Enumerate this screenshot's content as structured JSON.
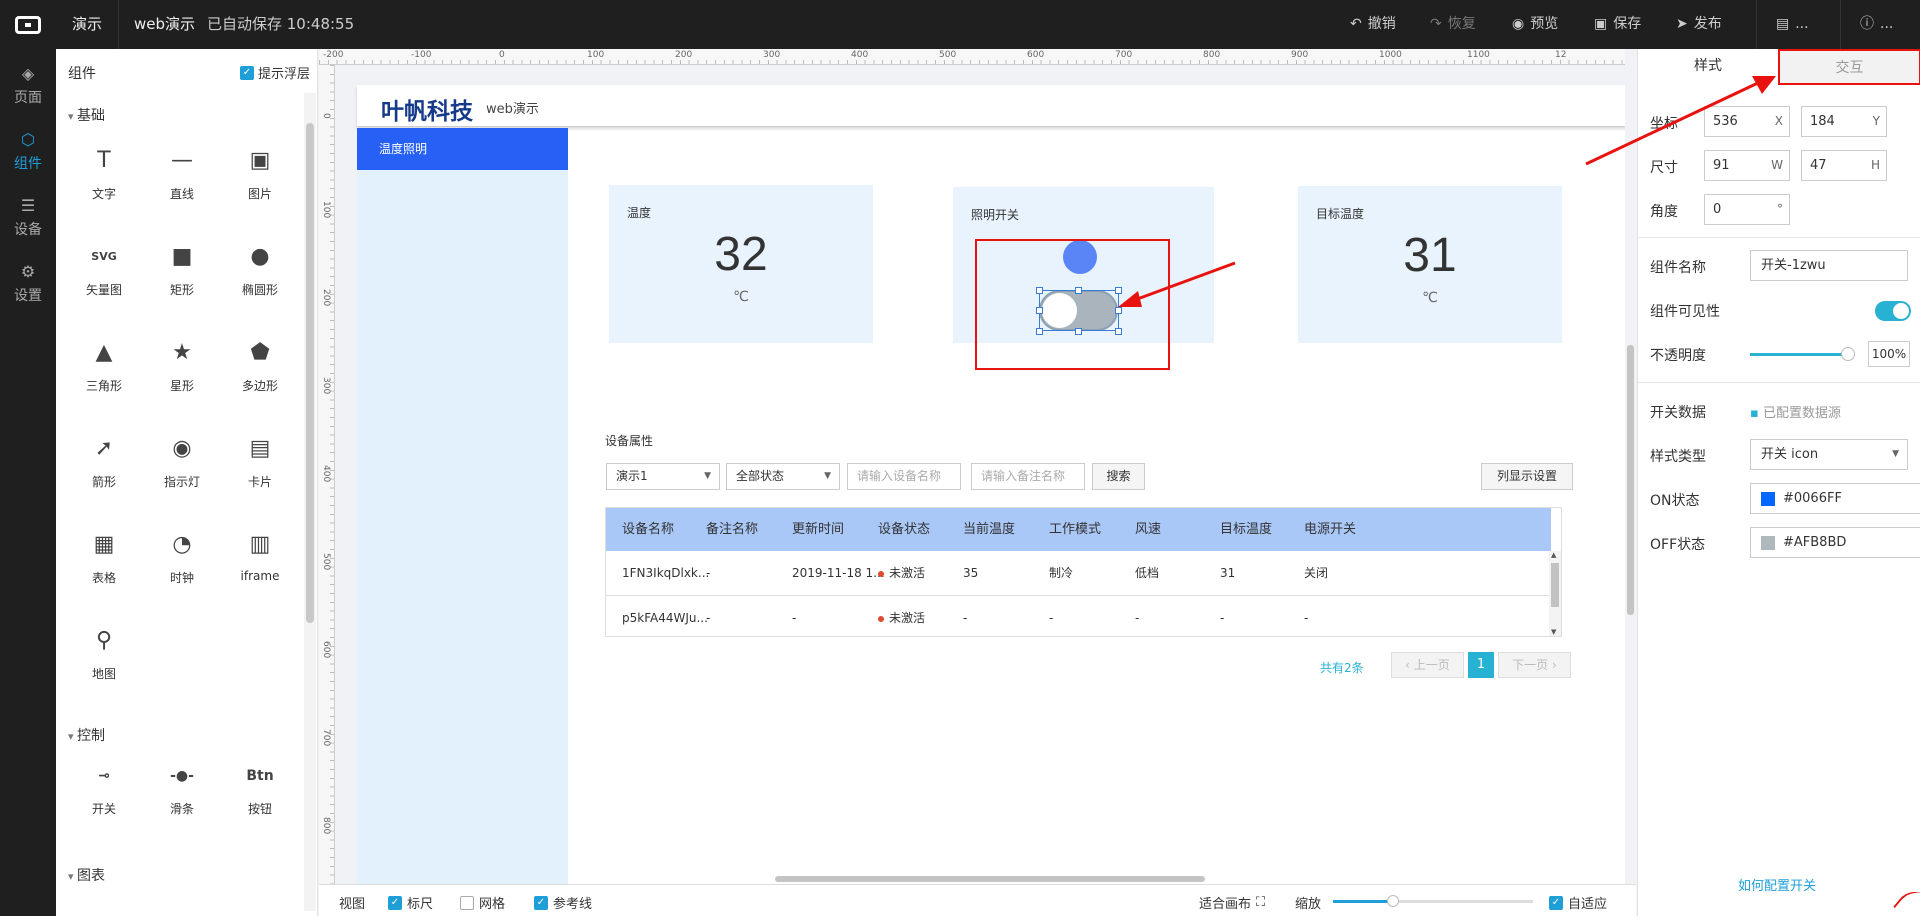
{
  "topbar": {
    "tab_active": "演示",
    "project": "web演示",
    "autosave": "已自动保存 10:48:55",
    "undo": "撤销",
    "redo": "恢复",
    "preview": "预览",
    "save": "保存",
    "publish": "发布",
    "more1": "...",
    "more2": "..."
  },
  "leftnav": [
    {
      "label": "页面",
      "icon": "layers-icon"
    },
    {
      "label": "组件",
      "icon": "cube-icon"
    },
    {
      "label": "设备",
      "icon": "device-icon"
    },
    {
      "label": "设置",
      "icon": "gear-icon"
    }
  ],
  "comp_panel": {
    "title": "组件",
    "tip": "提示浮层",
    "sections": {
      "basic": "基础",
      "control": "控制",
      "chart": "图表"
    },
    "basic_items": [
      {
        "label": "文字",
        "glyph": "T"
      },
      {
        "label": "直线",
        "glyph": "—"
      },
      {
        "label": "图片",
        "glyph": "▣"
      },
      {
        "label": "矢量图",
        "glyph": "SVG"
      },
      {
        "label": "矩形",
        "glyph": "■"
      },
      {
        "label": "椭圆形",
        "glyph": "●"
      },
      {
        "label": "三角形",
        "glyph": "▲"
      },
      {
        "label": "星形",
        "glyph": "★"
      },
      {
        "label": "多边形",
        "glyph": "⬟"
      },
      {
        "label": "箭形",
        "glyph": "➚"
      },
      {
        "label": "指示灯",
        "glyph": "◉"
      },
      {
        "label": "卡片",
        "glyph": "▤"
      },
      {
        "label": "表格",
        "glyph": "▦"
      },
      {
        "label": "时钟",
        "glyph": "◔"
      },
      {
        "label": "iframe",
        "glyph": "▥"
      },
      {
        "label": "地图",
        "glyph": "⚲"
      }
    ],
    "control_items": [
      {
        "label": "开关",
        "glyph": "⊸"
      },
      {
        "label": "滑条",
        "glyph": "-●-"
      },
      {
        "label": "按钮",
        "glyph": "Btn"
      }
    ]
  },
  "ruler": {
    "h_ticks": [
      "-200",
      "-100",
      "0",
      "100",
      "200",
      "300",
      "400",
      "500",
      "600",
      "700",
      "800",
      "900",
      "1000",
      "1100",
      "12"
    ],
    "v_ticks": [
      "0",
      "100",
      "200",
      "300",
      "400",
      "500",
      "600",
      "700",
      "800"
    ]
  },
  "page": {
    "brand": "叶帆科技",
    "brand_sub": "web演示",
    "side_item": "温度照明",
    "card_temp": {
      "title": "温度",
      "value": "32",
      "unit": "℃"
    },
    "card_light": {
      "title": "照明开关"
    },
    "card_target": {
      "title": "目标温度",
      "value": "31",
      "unit": "℃"
    },
    "device_title": "设备属性",
    "filter_select1": "演示1",
    "filter_select2": "全部状态",
    "filter_input1_ph": "请输入设备名称",
    "filter_input2_ph": "请输入备注名称",
    "search_btn": "搜索",
    "column_btn": "列显示设置",
    "table_headers": [
      "设备名称",
      "备注名称",
      "更新时间",
      "设备状态",
      "当前温度",
      "工作模式",
      "风速",
      "目标温度",
      "电源开关"
    ],
    "table_rows": [
      [
        "1FN3IkqDlxk...",
        "-",
        "2019-11-18 1...",
        "未激活",
        "35",
        "制冷",
        "低档",
        "31",
        "关闭"
      ],
      [
        "p5kFA44WJu...",
        "-",
        "-",
        "未激活",
        "-",
        "-",
        "-",
        "-",
        "-"
      ]
    ],
    "pager_total": "共有2条",
    "pager_prev": "上一页",
    "pager_current": "1",
    "pager_next": "下一页"
  },
  "bottombar": {
    "view": "视图",
    "ruler": "标尺",
    "grid": "网格",
    "guides": "参考线",
    "fit": "适合画布",
    "zoom": "缩放",
    "zoom_level": 0.3,
    "auto": "自适应"
  },
  "rpanel": {
    "tab_style": "样式",
    "tab_interact": "交互",
    "coord_label": "坐标",
    "x": "536",
    "x_unit": "X",
    "y": "184",
    "y_unit": "Y",
    "size_label": "尺寸",
    "w": "91",
    "w_unit": "W",
    "h": "47",
    "h_unit": "H",
    "angle_label": "角度",
    "angle": "0",
    "angle_unit": "°",
    "name_label": "组件名称",
    "name": "开关-1zwu",
    "visible_label": "组件可见性",
    "visible": true,
    "opacity_label": "不透明度",
    "opacity": "100%",
    "data_label": "开关数据",
    "data_value": "已配置数据源",
    "style_label": "样式类型",
    "style_value": "开关 icon",
    "on_label": "ON状态",
    "on_color": "#0066FF",
    "off_label": "OFF状态",
    "off_color": "#AFB8BD",
    "help": "如何配置开关"
  },
  "colors": {
    "accent": "#1e9fd8",
    "brand_blue": "#2760f5",
    "annotation_red": "#e8130f"
  }
}
